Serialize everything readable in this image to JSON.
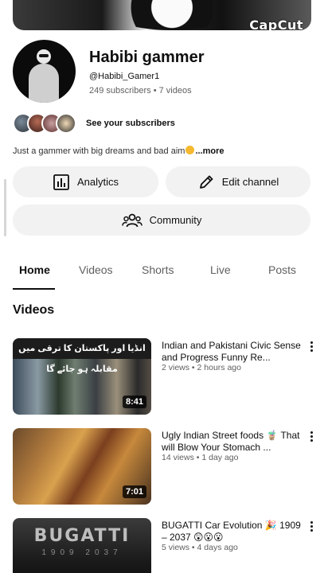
{
  "watermark": "CapCut",
  "channel": {
    "name": "Habibi gammer",
    "handle": "@Habibi_Gamer1",
    "stats": "249 subscribers • 7 videos",
    "see_subscribers": "See your subscribers",
    "description": "Just a gammer with big dreams and bad aim",
    "description_more": "...more"
  },
  "buttons": {
    "analytics": "Analytics",
    "edit_channel": "Edit channel",
    "community": "Community"
  },
  "tabs": [
    {
      "label": "Home",
      "active": true
    },
    {
      "label": "Videos",
      "active": false
    },
    {
      "label": "Shorts",
      "active": false
    },
    {
      "label": "Live",
      "active": false
    },
    {
      "label": "Posts",
      "active": false
    }
  ],
  "section_title": "Videos",
  "videos": [
    {
      "title": "Indian and Pakistani Civic Sense and Progress Funny Re...",
      "meta": "2 views • 2 hours ago",
      "duration": "8:41",
      "thumb_text": "انڈیا اور پاکستان کا ترقی میں مقابلہ ہو جائے گا"
    },
    {
      "title": "Ugly Indian Street foods 🧋 That will Blow Your Stomach ...",
      "meta": "14 views • 1 day ago",
      "duration": "7:01"
    },
    {
      "title": "BUGATTI Car Evolution 🎉 1909 – 2037 😲😮😮",
      "meta": "5 views • 4 days ago",
      "thumb_text": "BUGATTI",
      "thumb_sub": "1909 2037"
    }
  ]
}
